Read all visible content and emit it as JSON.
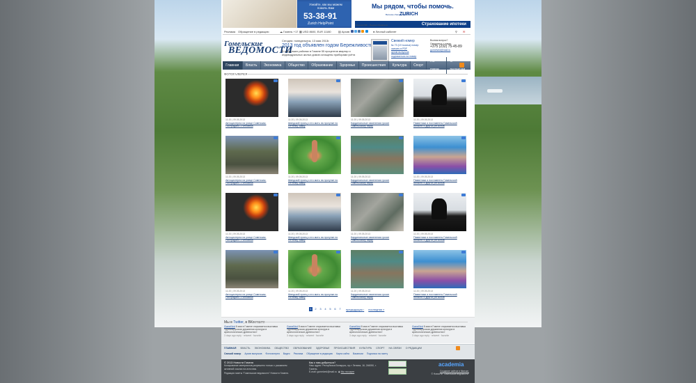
{
  "banner": {
    "question": "Узнайте, как мы можем помочь Вам",
    "phone": "53-38-91",
    "helppoint": "Zurich HelpPoint",
    "slogan": "Мы рядом, чтобы помочь.",
    "because": "Because change happenz",
    "zurich": "ZURICH",
    "mortgage": "Страхование ипотеки",
    "small": "Лицензия МФ.... Выдана Минфином"
  },
  "utilbar": {
    "ads": "Реклама",
    "contact": "Обращение в редакцию",
    "weather": "Гомель +17",
    "usd": "USD 8600, EUR 11180",
    "archive": "Архив",
    "cabinet": "Личный кабинет"
  },
  "header": {
    "logo_line1": "Гомельские",
    "logo_line2": "ВЕДОМОСТИ",
    "today": "Сегодня: понедельник, 13 мая 2013г.",
    "headline": "2013 год объявлен годом Бережливости",
    "lead": "В нескольких районах в Гомеле 55 процентов квартир и индивидуальных жилых домов оснащены приборами учёта",
    "fresh_title": "Свежий номер",
    "fresh_lines": [
      "№ 73 (19 тысяча) номер",
      "скачать в PDF",
      "архив выпусков",
      "подписаться на номер"
    ],
    "contacts_q": "Возник вопрос?",
    "contacts_call": "Свяжитесь с нами:",
    "contacts_tel": "+375 (232) 75-45-89",
    "contacts_mail": "gomelved@mail.ru"
  },
  "nav": {
    "items": [
      "Главная",
      "Власть",
      "Экономика",
      "Общество",
      "Образование",
      "Здоровье",
      "Происшествия",
      "Культура",
      "Спорт",
      "На связи",
      "О редакции"
    ]
  },
  "section_title": "ФОТОГАЛЕРЕЯ",
  "gallery": [
    {
      "meta": "11:20 | 09.05.2013",
      "caption": "Автоцистерна на улице Советская. Пострадало 3 человека"
    },
    {
      "meta": "11:20 | 09.05.2013",
      "caption": "Шведский принц и его мать на прогулке по Летнему замку"
    },
    {
      "meta": "11:20 | 09.05.2013",
      "caption": "Кардинальные изменения грозят Гомельскому парку"
    },
    {
      "meta": "11:20 | 09.05.2013",
      "caption": "Памятники и постаменты Гомельской области и других регионов"
    },
    {
      "meta": "11:20 | 09.05.2013",
      "caption": "Автоцистерна на улице Советская. Пострадало 3 человека"
    },
    {
      "meta": "11:20 | 09.05.2013",
      "caption": "Шведский принц и его мать на прогулке по Летнему замку"
    },
    {
      "meta": "11:20 | 09.05.2013",
      "caption": "Кардинальные изменения грозят Гомельскому парку"
    },
    {
      "meta": "11:20 | 09.05.2013",
      "caption": "Памятники и постаменты Гомельской области и других регионов"
    },
    {
      "meta": "11:20 | 09.05.2013",
      "caption": "Автоцистерна на улице Советская. Пострадало 3 человека"
    },
    {
      "meta": "11:20 | 09.05.2013",
      "caption": "Шведский принц и его мать на прогулке по Летнему замку"
    },
    {
      "meta": "11:20 | 09.05.2013",
      "caption": "Кардинальные изменения грозят Гомельскому парку"
    },
    {
      "meta": "11:20 | 09.05.2013",
      "caption": "Памятники и постаменты Гомельской области и других регионов"
    },
    {
      "meta": "11:20 | 09.05.2013",
      "caption": "Автоцистерна на улице Советская. Пострадало 3 человека"
    },
    {
      "meta": "11:20 | 09.05.2013",
      "caption": "Шведский принц и его мать на прогулке по Летнему замку"
    },
    {
      "meta": "11:20 | 09.05.2013",
      "caption": "Кардинальные изменения грозят Гомельскому парку"
    },
    {
      "meta": "11:20 | 09.05.2013",
      "caption": "Памятники и постаменты Гомельской области и других регионов"
    }
  ],
  "pager": {
    "pages": [
      "1",
      "2",
      "3",
      "4",
      "5",
      "6",
      "7"
    ],
    "prev": "предыдущая",
    "last": "последняя"
  },
  "vk": {
    "title_pre": "Мы в",
    "twitter": "Twitter",
    "title_mid": ", в ВКонтакте",
    "items": [
      {
        "link": "GomelVed",
        "text": "8 мая в Гомеле открывается выставка «Древнерусская дружинная культура в археологических древностях»",
        "ago": "3 days ago",
        "acts": "reply · retweet · favorite"
      },
      {
        "link": "GomelVed",
        "text": "8 мая в Гомеле открывается выставка «Древнерусская дружинная культура в археологических древностях»",
        "ago": "3 days ago",
        "acts": "reply · retweet · favorite"
      },
      {
        "link": "GomelVed",
        "text": "8 мая в Гомеле открывается выставка «Древнерусская дружинная культура в археологических древностях»",
        "ago": "3 days ago",
        "acts": "reply · retweet · favorite"
      },
      {
        "link": "GomelVed",
        "text": "8 мая в Гомеле открывается выставка «Древнерусская дружинная культура в археологических древностях»",
        "ago": "3 days ago",
        "acts": "reply · retweet · favorite"
      }
    ]
  },
  "footer_nav": {
    "items": [
      "ГЛАВНАЯ",
      "ВЛАСТЬ",
      "ЭКОНОМИКА",
      "ОБЩЕСТВО",
      "ОБРАЗОВАНИЕ",
      "ЗДОРОВЬЕ",
      "ПРОИСШЕСТВИЯ",
      "КУЛЬТУРА",
      "СПОРТ",
      "НА СВЯЗИ",
      "О РЕДАКЦИИ"
    ],
    "sub": [
      "Свежий номер",
      "Архив выпусков",
      "Фотогалерея",
      "Видео",
      "Реклама",
      "Обращение в редакцию",
      "Карта сайта",
      "Вакансии",
      "Подписка на газету"
    ]
  },
  "footer": {
    "copy": "© 2013 Новости Гомеля",
    "legal": "Копирование материалов разрешено только с указанием активной ссылки на источник.",
    "redakcia": "Редакция газеты \"Гомельские ведомости\" Новости Гомеля.",
    "how_title": "Как к нам добраться?",
    "address": "Наш адрес: Республика Беларусь, пр-т Ленина, 16, 246050, г. Гомель.",
    "email": "E-mail: gomelved@mail.ru",
    "map": "Мы на карте",
    "academia": "academia",
    "made_in": "Создание сайтов в Минске.",
    "made_for": "© Новости \"Гомельские ведомости\""
  }
}
